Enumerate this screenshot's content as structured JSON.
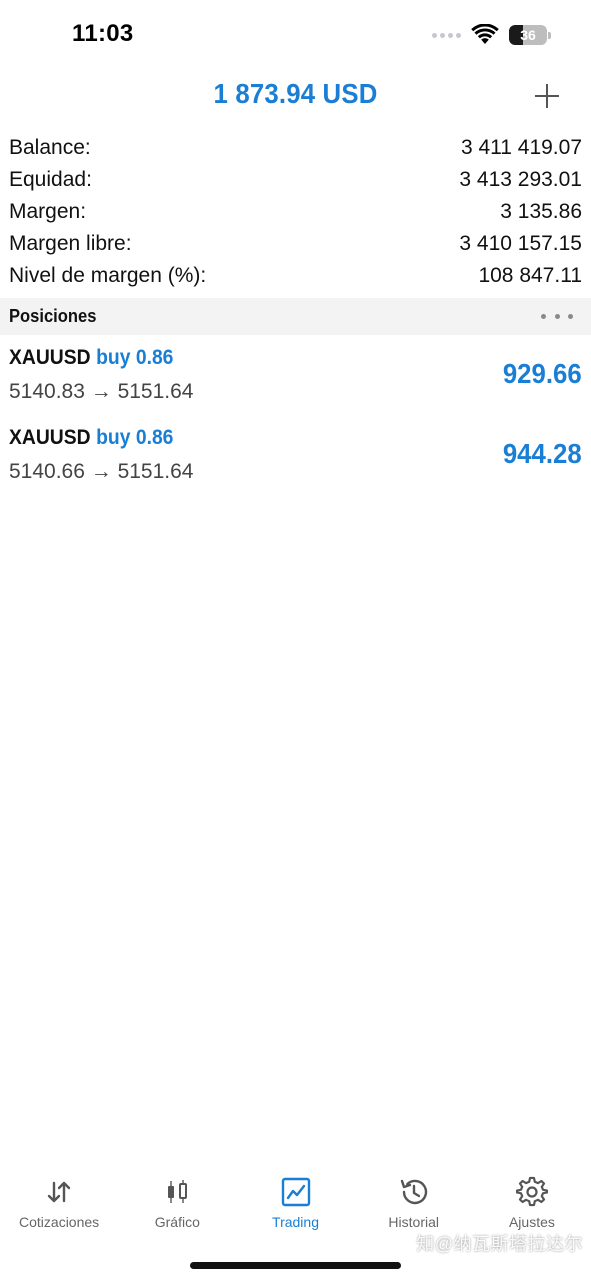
{
  "status_bar": {
    "time": "11:03",
    "battery_level": "36",
    "battery_fraction": 0.36
  },
  "header": {
    "title": "1 873.94 USD",
    "add_icon": "plus-icon"
  },
  "summary": [
    {
      "label": "Balance:",
      "value": "3 411 419.07"
    },
    {
      "label": "Equidad:",
      "value": "3 413 293.01"
    },
    {
      "label": "Margen:",
      "value": "3 135.86"
    },
    {
      "label": "Margen libre:",
      "value": "3 410 157.15"
    },
    {
      "label": "Nivel de margen (%):",
      "value": "108 847.11"
    }
  ],
  "positions_section": {
    "title": "Posiciones",
    "more_icon": "more-horizontal-icon"
  },
  "positions": [
    {
      "symbol": "XAUUSD",
      "side": "buy 0.86",
      "prices": "5140.83 → 5151.64",
      "profit": "929.66"
    },
    {
      "symbol": "XAUUSD",
      "side": "buy 0.86",
      "prices": "5140.66 → 5151.64",
      "profit": "944.28"
    }
  ],
  "tabs": [
    {
      "label": "Cotizaciones",
      "icon": "quotes-arrows-icon"
    },
    {
      "label": "Gráfico",
      "icon": "candlestick-chart-icon"
    },
    {
      "label": "Trading",
      "icon": "trading-chart-icon",
      "active": true
    },
    {
      "label": "Historial",
      "icon": "history-icon"
    },
    {
      "label": "Ajustes",
      "icon": "settings-gear-icon"
    }
  ],
  "watermark": "知@纳瓦斯塔拉达尔",
  "colors": {
    "accent": "#1a7fd4",
    "text": "#111111",
    "secondary_text": "#444444",
    "tab_inactive": "#666666",
    "section_bg": "#f3f3f3"
  }
}
